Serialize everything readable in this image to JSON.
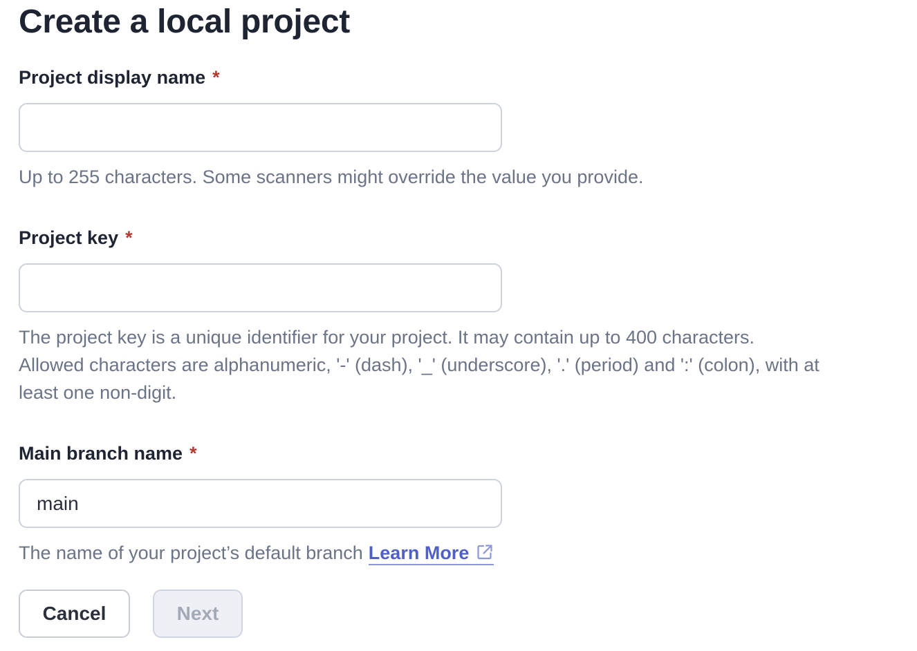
{
  "page": {
    "title": "Create a local project"
  },
  "fields": {
    "display_name": {
      "label": "Project display name",
      "required_marker": "*",
      "value": "",
      "help": "Up to 255 characters. Some scanners might override the value you provide."
    },
    "project_key": {
      "label": "Project key",
      "required_marker": "*",
      "value": "",
      "help_line1": "The project key is a unique identifier for your project. It may contain up to 400 characters.",
      "help_line2": "Allowed characters are alphanumeric, '-' (dash), '_' (underscore), '.' (period) and ':' (colon), with at",
      "help_line3": "least one non-digit."
    },
    "main_branch": {
      "label": "Main branch name",
      "required_marker": "*",
      "value": "main",
      "help": "The name of your project’s default branch",
      "link_label": "Learn More",
      "link_icon": "external-link-icon"
    }
  },
  "actions": {
    "cancel_label": "Cancel",
    "next_label": "Next",
    "next_disabled": true
  },
  "colors": {
    "required": "#b53a2f",
    "link": "#5160c6",
    "help_text": "#6b7386",
    "heading": "#1f2433"
  }
}
